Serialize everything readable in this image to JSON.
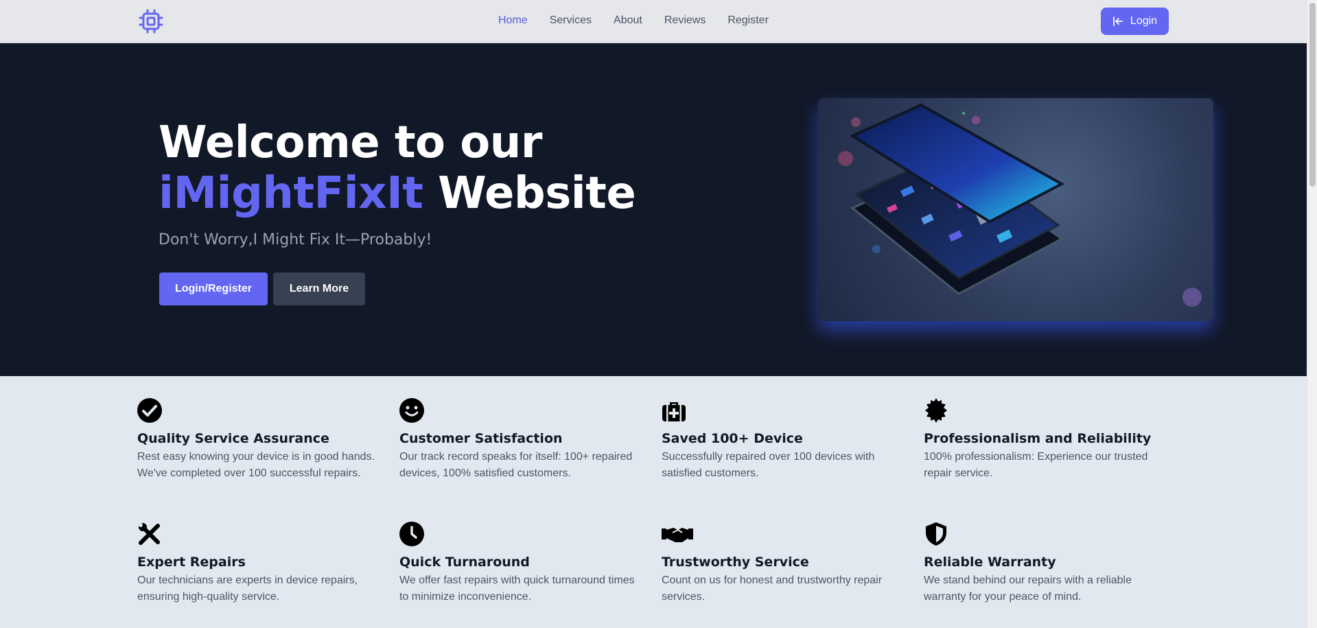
{
  "header": {
    "logo_icon": "cpu-chip-icon",
    "nav": [
      "Home",
      "Services",
      "About",
      "Reviews",
      "Register"
    ],
    "active_nav": "Home",
    "login_label": "Login",
    "login_icon": "arrow-to-left-icon"
  },
  "hero": {
    "title_line1": "Welcome to our",
    "title_accent": "iMightFixIt",
    "title_rest": " Website",
    "subtitle": "Don't Worry,I Might Fix It—Probably!",
    "primary_button": "Login/Register",
    "secondary_button": "Learn More",
    "image_icon": "exploded-smartphone-illustration"
  },
  "features": [
    {
      "icon": "check-circle-icon",
      "title": "Quality Service Assurance",
      "text": "Rest easy knowing your device is in good hands. We've completed over 100 successful repairs."
    },
    {
      "icon": "smile-icon",
      "title": "Customer Satisfaction",
      "text": "Our track record speaks for itself: 100+ repaired devices, 100% satisfied customers."
    },
    {
      "icon": "medical-kit-icon",
      "title": "Saved 100+ Device",
      "text": "Successfully repaired over 100 devices with satisfied customers."
    },
    {
      "icon": "badge-icon",
      "title": "Professionalism and Reliability",
      "text": "100% professionalism: Experience our trusted repair service."
    },
    {
      "icon": "tools-icon",
      "title": "Expert Repairs",
      "text": "Our technicians are experts in device repairs, ensuring high-quality service."
    },
    {
      "icon": "clock-icon",
      "title": "Quick Turnaround",
      "text": "We offer fast repairs with quick turnaround times to minimize inconvenience."
    },
    {
      "icon": "handshake-icon",
      "title": "Trustworthy Service",
      "text": "Count on us for honest and trustworthy repair services."
    },
    {
      "icon": "shield-icon",
      "title": "Reliable Warranty",
      "text": "We stand behind our repairs with a reliable warranty for your peace of mind."
    }
  ],
  "colors": {
    "accent": "#6366f1",
    "hero_bg": "#111827",
    "page_bg": "#e2e8f0",
    "header_bg": "#e5e7eb"
  }
}
